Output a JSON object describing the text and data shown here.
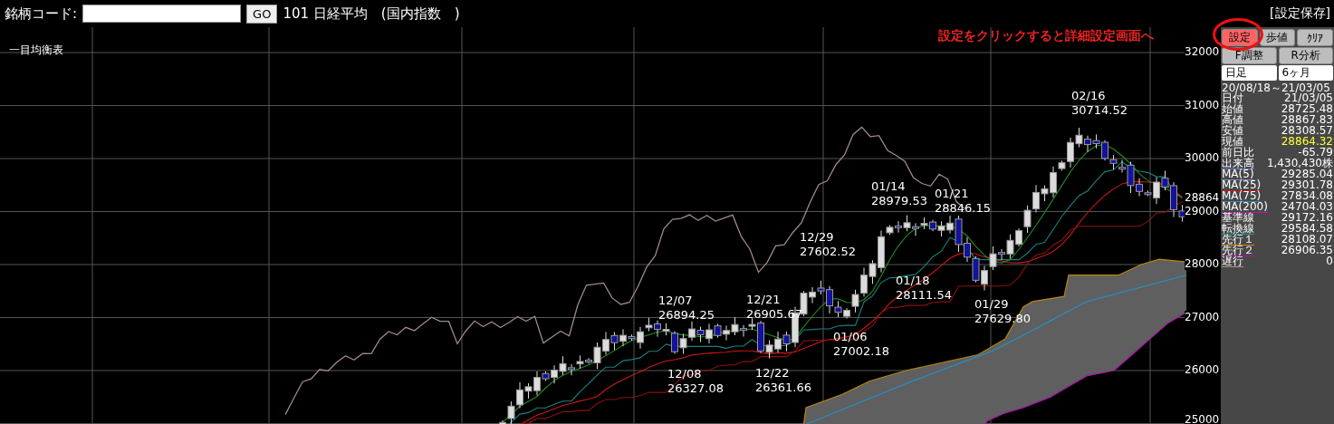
{
  "header": {
    "code_label": "銘柄コード:",
    "go_button": "GO",
    "symbol": "101 日経平均　(国内指数　)",
    "save_link": "[設定保存]"
  },
  "chart": {
    "legend": "一目均衡表",
    "callout": "設定をクリックすると詳細設定画面へ",
    "y_labels": [
      {
        "text": "32000",
        "kind": "tick"
      },
      {
        "text": "31000",
        "kind": "tick"
      },
      {
        "text": "30000",
        "kind": "tick"
      },
      {
        "text": "28864",
        "kind": "current"
      },
      {
        "text": "29000",
        "kind": "tick"
      },
      {
        "text": "28000",
        "kind": "tick"
      },
      {
        "text": "27000",
        "kind": "tick"
      },
      {
        "text": "26000",
        "kind": "tick"
      },
      {
        "text": "25000",
        "kind": "tick"
      }
    ],
    "annotations": [
      {
        "date": "02/16",
        "value": "30714.52"
      },
      {
        "date": "01/14",
        "value": "28979.53"
      },
      {
        "date": "01/21",
        "value": "28846.15"
      },
      {
        "date": "12/29",
        "value": "27602.52"
      },
      {
        "date": "12/07",
        "value": "26894.25"
      },
      {
        "date": "12/21",
        "value": "26905.67"
      },
      {
        "date": "01/18",
        "value": "28111.54"
      },
      {
        "date": "01/29",
        "value": "27629.80"
      },
      {
        "date": "01/06",
        "value": "27002.18"
      },
      {
        "date": "12/08",
        "value": "26327.08"
      },
      {
        "date": "12/22",
        "value": "26361.66"
      }
    ]
  },
  "sidebar": {
    "buttons": [
      {
        "label": "設定",
        "highlighted": true
      },
      {
        "label": "歩値",
        "highlighted": false
      },
      {
        "label": "ｸﾘｱ",
        "highlighted": false
      },
      {
        "label": "F調整",
        "highlighted": false
      },
      {
        "label": "R分析",
        "highlighted": false
      }
    ],
    "selects": [
      {
        "value": "日足"
      },
      {
        "value": "6ヶ月"
      }
    ],
    "range": "20/08/18～21/03/05",
    "rows": [
      {
        "label": "日付",
        "value": "21/03/05",
        "highlighted": false
      },
      {
        "label": "始値",
        "value": "28725.48",
        "highlighted": false
      },
      {
        "label": "高値",
        "value": "28867.83",
        "highlighted": false
      },
      {
        "label": "安値",
        "value": "28308.57",
        "highlighted": false
      },
      {
        "label": "現値",
        "value": "28864.32",
        "highlighted": true
      },
      {
        "label": "前日比",
        "value": "-65.79",
        "highlighted": false
      },
      {
        "label": "出来高",
        "value": "1,430,430株",
        "highlighted": false,
        "color": "#6a7ad8"
      },
      {
        "label": "MA(5)",
        "value": "29285.04",
        "highlighted": false,
        "color": "#7a82d0"
      },
      {
        "label": "MA(25)",
        "value": "29301.78",
        "highlighted": false,
        "color": "#cc1111"
      },
      {
        "label": "MA(75)",
        "value": "27834.08",
        "highlighted": false,
        "color": "#2a8cc0"
      },
      {
        "label": "MA(200)",
        "value": "24704.03",
        "highlighted": false,
        "color": "#c010c0"
      },
      {
        "label": "基準線",
        "value": "29172.16",
        "highlighted": false
      },
      {
        "label": "転換線",
        "value": "29584.58",
        "highlighted": false,
        "color": "#1a9a9a"
      },
      {
        "label": "先行１",
        "value": "28108.07",
        "highlighted": false,
        "color": "#c89018"
      },
      {
        "label": "先行２",
        "value": "26906.35",
        "highlighted": false,
        "color": "#b010b0"
      },
      {
        "label": "遅行",
        "value": "0",
        "highlighted": false,
        "color": "#b09090"
      }
    ]
  }
}
